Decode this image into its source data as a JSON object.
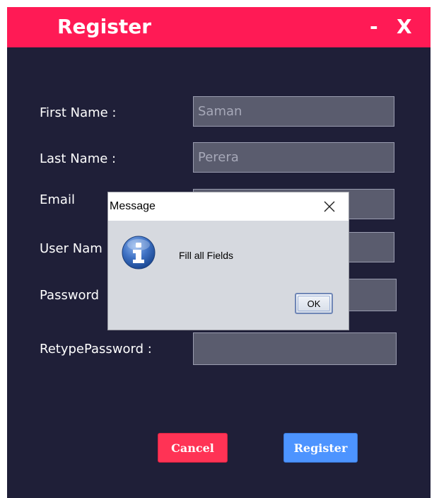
{
  "window": {
    "title": "Register",
    "minimize_label": "-",
    "close_label": "X",
    "colors": {
      "background": "#1f1f38",
      "titlebar": "#ff1a55"
    }
  },
  "form": {
    "first_name": {
      "label": "First Name :",
      "value": "Saman"
    },
    "last_name": {
      "label": "Last Name :",
      "value": "Perera"
    },
    "email": {
      "label": "Email",
      "value": ""
    },
    "user_name": {
      "label": "User Nam",
      "value": ""
    },
    "password": {
      "label": "Password",
      "value": ""
    },
    "retype_password": {
      "label": "RetypePassword :",
      "value": ""
    }
  },
  "buttons": {
    "cancel_label": "Cancel",
    "register_label": "Register",
    "cancel_color": "#ff3355",
    "register_color": "#4d94ff"
  },
  "dialog": {
    "title": "Message",
    "icon": "info-icon",
    "message": "Fill all Fields",
    "ok_label": "OK"
  }
}
